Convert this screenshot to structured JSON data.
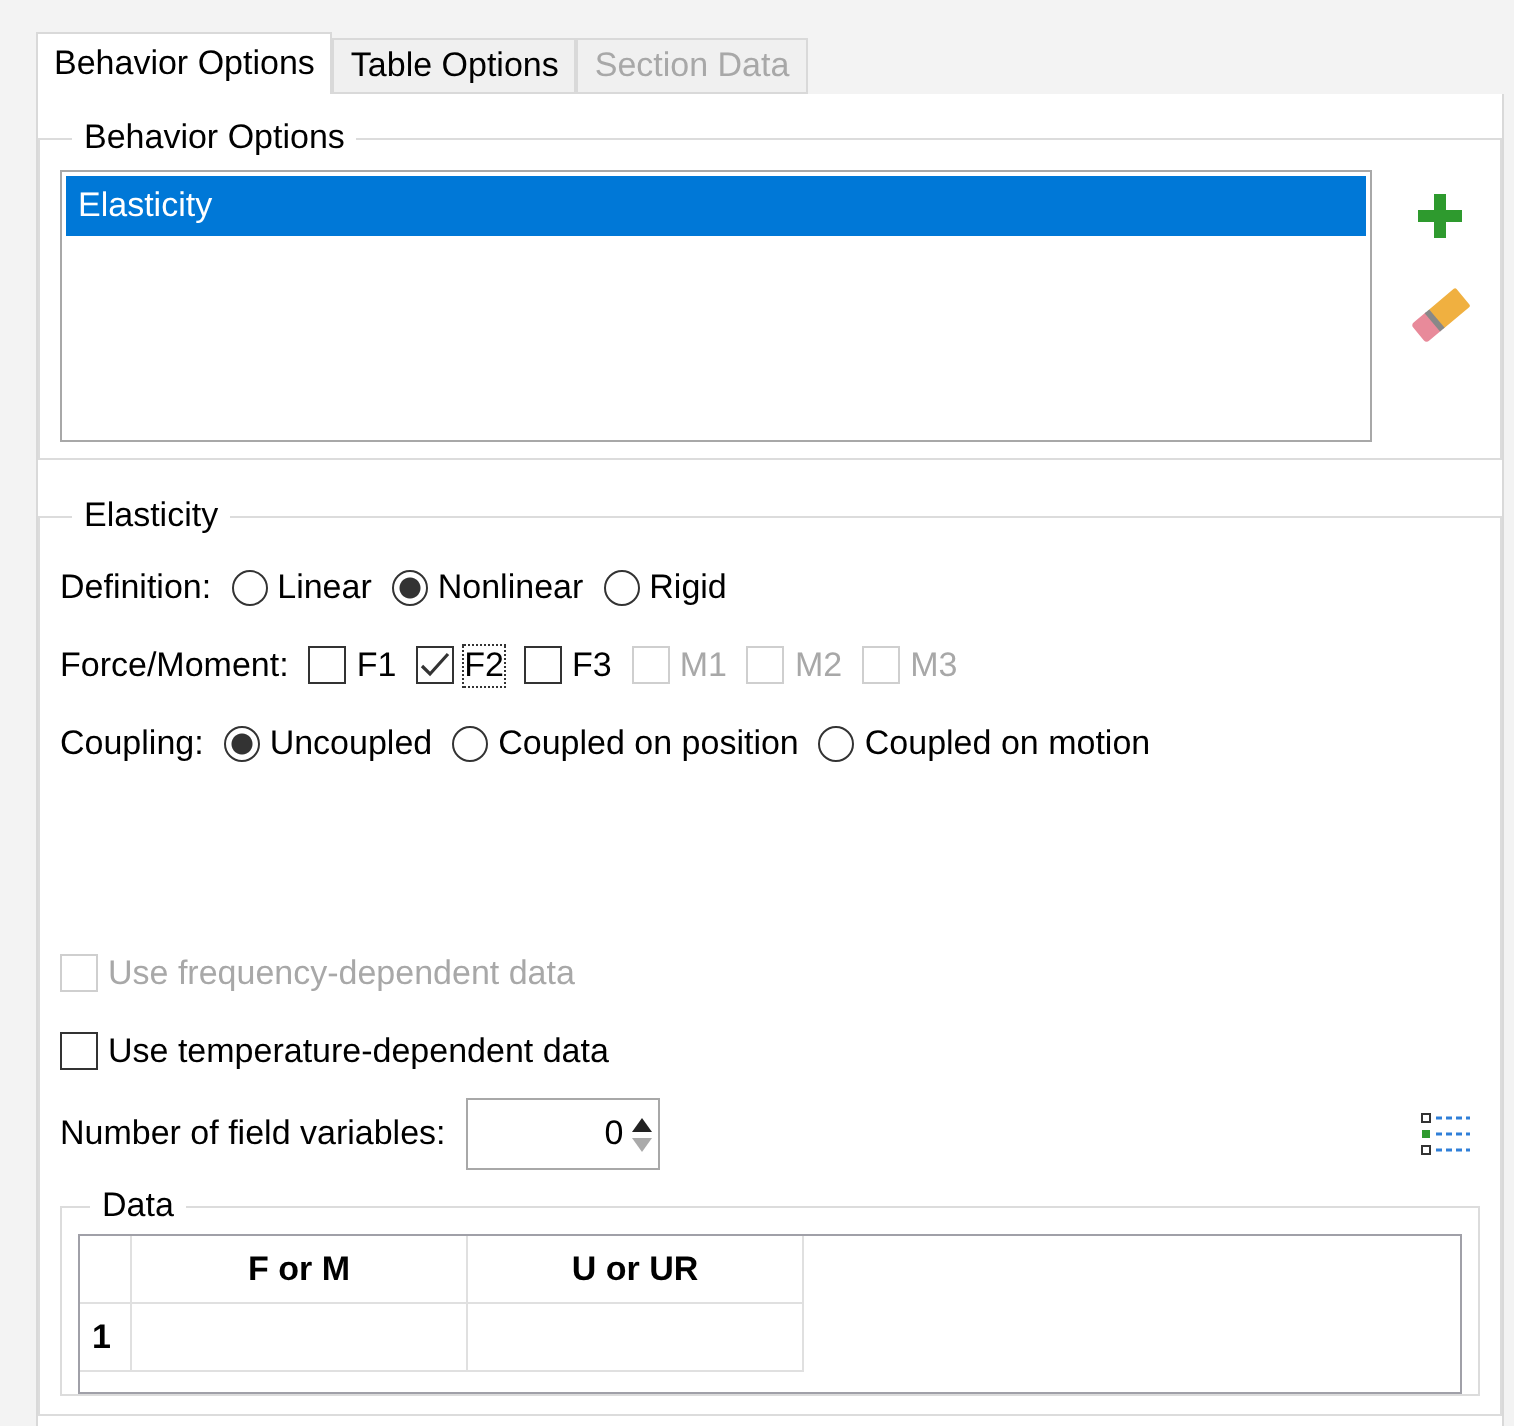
{
  "tabs": [
    {
      "label": "Behavior Options",
      "selected": true,
      "disabled": false
    },
    {
      "label": "Table Options",
      "selected": false,
      "disabled": false
    },
    {
      "label": "Section Data",
      "selected": false,
      "disabled": true
    }
  ],
  "behavior_group": {
    "title": "Behavior Options",
    "items": [
      {
        "label": "Elasticity",
        "selected": true
      }
    ]
  },
  "elasticity_group": {
    "title": "Elasticity",
    "definition": {
      "label": "Definition:",
      "options": [
        {
          "label": "Linear",
          "selected": false
        },
        {
          "label": "Nonlinear",
          "selected": true
        },
        {
          "label": "Rigid",
          "selected": false
        }
      ]
    },
    "force_moment": {
      "label": "Force/Moment:",
      "options": [
        {
          "label": "F1",
          "checked": false,
          "disabled": false,
          "focused": false
        },
        {
          "label": "F2",
          "checked": true,
          "disabled": false,
          "focused": true
        },
        {
          "label": "F3",
          "checked": false,
          "disabled": false,
          "focused": false
        },
        {
          "label": "M1",
          "checked": false,
          "disabled": true,
          "focused": false
        },
        {
          "label": "M2",
          "checked": false,
          "disabled": true,
          "focused": false
        },
        {
          "label": "M3",
          "checked": false,
          "disabled": true,
          "focused": false
        }
      ]
    },
    "coupling": {
      "label": "Coupling:",
      "options": [
        {
          "label": "Uncoupled",
          "selected": true
        },
        {
          "label": "Coupled on position",
          "selected": false
        },
        {
          "label": "Coupled on motion",
          "selected": false
        }
      ]
    },
    "options": [
      {
        "label": "Use frequency-dependent data",
        "checked": false,
        "disabled": true
      },
      {
        "label": "Use temperature-dependent data",
        "checked": false,
        "disabled": false
      }
    ],
    "field_variables": {
      "label": "Number of field variables:",
      "value": "0"
    },
    "data": {
      "title": "Data",
      "columns": [
        "F or M",
        "U or UR"
      ],
      "rows": [
        {
          "number": "1",
          "cells": [
            "",
            ""
          ]
        }
      ]
    }
  }
}
